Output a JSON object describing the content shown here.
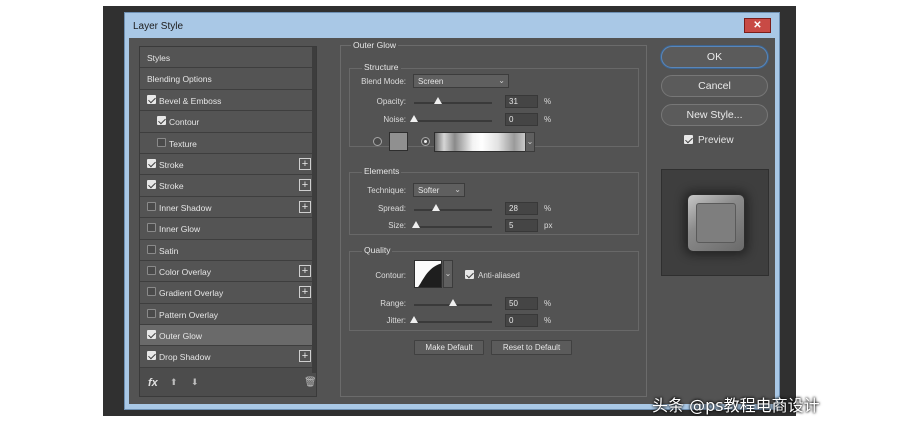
{
  "window": {
    "title": "Layer Style",
    "close_symbol": "✕"
  },
  "effects_list": [
    {
      "label": "Styles",
      "checkbox": null,
      "plus": false,
      "indent": 0
    },
    {
      "label": "Blending Options",
      "checkbox": null,
      "plus": false,
      "indent": 0
    },
    {
      "label": "Bevel & Emboss",
      "checkbox": true,
      "plus": false,
      "indent": 0
    },
    {
      "label": "Contour",
      "checkbox": true,
      "plus": false,
      "indent": 1
    },
    {
      "label": "Texture",
      "checkbox": false,
      "plus": false,
      "indent": 1
    },
    {
      "label": "Stroke",
      "checkbox": true,
      "plus": true,
      "indent": 0
    },
    {
      "label": "Stroke",
      "checkbox": true,
      "plus": true,
      "indent": 0
    },
    {
      "label": "Inner Shadow",
      "checkbox": false,
      "plus": true,
      "indent": 0
    },
    {
      "label": "Inner Glow",
      "checkbox": false,
      "plus": false,
      "indent": 0
    },
    {
      "label": "Satin",
      "checkbox": false,
      "plus": false,
      "indent": 0
    },
    {
      "label": "Color Overlay",
      "checkbox": false,
      "plus": true,
      "indent": 0
    },
    {
      "label": "Gradient Overlay",
      "checkbox": false,
      "plus": true,
      "indent": 0
    },
    {
      "label": "Pattern Overlay",
      "checkbox": false,
      "plus": false,
      "indent": 0
    },
    {
      "label": "Outer Glow",
      "checkbox": true,
      "plus": false,
      "indent": 0,
      "selected": true
    },
    {
      "label": "Drop Shadow",
      "checkbox": true,
      "plus": true,
      "indent": 0
    }
  ],
  "fx_toolbar": {
    "fx": "fx",
    "up": "⬆",
    "down": "⬇",
    "trash": "🗑"
  },
  "outer_glow": {
    "title": "Outer Glow",
    "structure": {
      "title": "Structure",
      "blend_mode_label": "Blend Mode:",
      "blend_mode": "Screen",
      "opacity_label": "Opacity:",
      "opacity": "31",
      "opacity_unit": "%",
      "opacity_level": 0.31,
      "noise_label": "Noise:",
      "noise": "0",
      "noise_unit": "%",
      "noise_level": 0.0,
      "color_swatch": "#909090"
    },
    "elements": {
      "title": "Elements",
      "technique_label": "Technique:",
      "technique": "Softer",
      "spread_label": "Spread:",
      "spread": "28",
      "spread_unit": "%",
      "spread_level": 0.28,
      "size_label": "Size:",
      "size": "5",
      "size_unit": "px",
      "size_level": 0.02
    },
    "quality": {
      "title": "Quality",
      "contour_label": "Contour:",
      "anti_aliased_label": "Anti-aliased",
      "anti_aliased": true,
      "range_label": "Range:",
      "range": "50",
      "range_unit": "%",
      "range_level": 0.5,
      "jitter_label": "Jitter:",
      "jitter": "0",
      "jitter_unit": "%",
      "jitter_level": 0.0
    },
    "make_default": "Make Default",
    "reset_default": "Reset to Default"
  },
  "actions": {
    "ok": "OK",
    "cancel": "Cancel",
    "new_style": "New Style...",
    "preview_label": "Preview",
    "preview_checked": true
  },
  "watermark": "头条 @ps教程电商设计"
}
